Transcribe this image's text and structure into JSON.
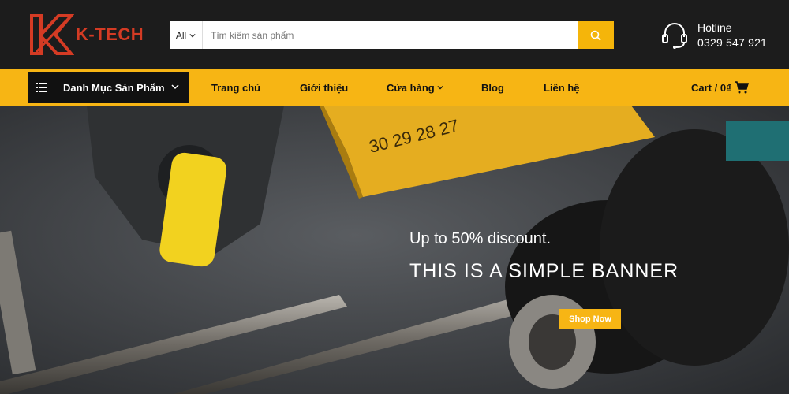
{
  "brand": {
    "name": "K-TECH",
    "color": "#d43b24"
  },
  "search": {
    "category": "All",
    "placeholder": "Tìm kiếm sản phẩm",
    "value": ""
  },
  "hotline": {
    "label": "Hotline",
    "phone": "0329 547 921"
  },
  "nav": {
    "category_menu": "Danh Mục Sản Phẩm",
    "items": [
      {
        "label": "Trang chủ"
      },
      {
        "label": "Giới thiệu"
      },
      {
        "label": "Cửa hàng"
      },
      {
        "label": "Blog"
      },
      {
        "label": "Liên hệ"
      }
    ],
    "cart": "Cart / 0₫"
  },
  "banner": {
    "subtitle": "Up to 50% discount.",
    "title": "THIS IS A SIMPLE BANNER",
    "button": "Shop Now"
  },
  "icons": {
    "search": "search-icon",
    "headset": "headset-icon",
    "list": "list-icon",
    "cart": "cart-icon",
    "chevron": "chevron-down-icon"
  },
  "colors": {
    "accent": "#f7b514",
    "header_bg": "#1c1c1c",
    "menu_bg": "#111111"
  }
}
